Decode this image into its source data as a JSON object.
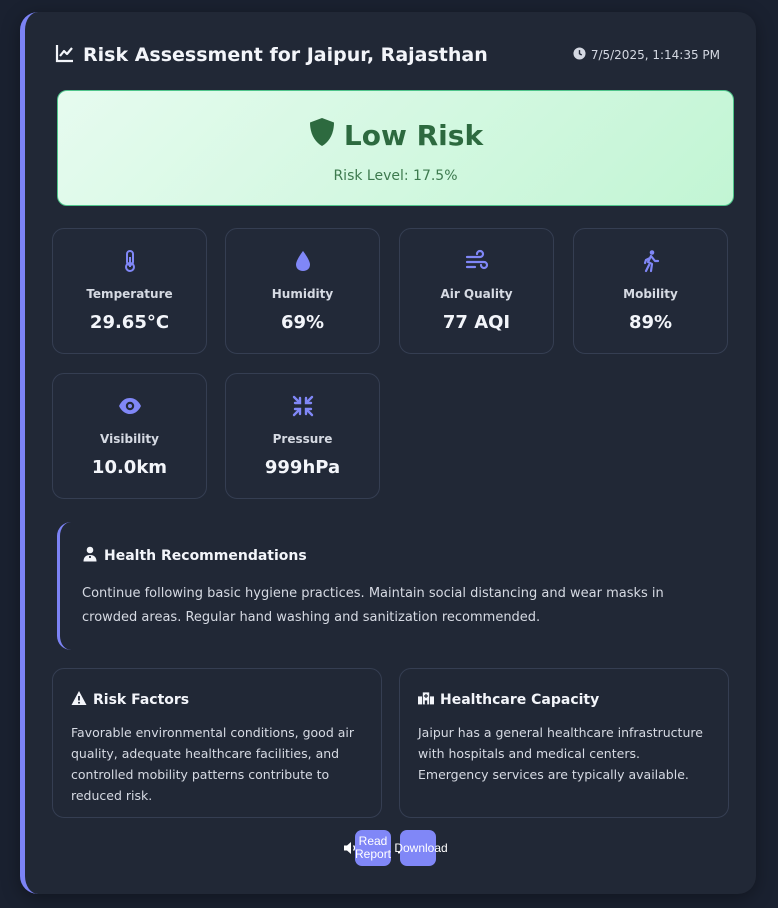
{
  "header": {
    "title": "Risk Assessment for Jaipur, Rajasthan",
    "timestamp": "7/5/2025, 1:14:35 PM",
    "title_icon": "chart-line-icon",
    "timestamp_icon": "clock-icon"
  },
  "risk": {
    "label": "Low Risk",
    "level_text": "Risk Level: 17.5%",
    "icon": "shield-icon"
  },
  "metrics": [
    {
      "label": "Temperature",
      "value": "29.65°C",
      "icon": "thermometer-icon"
    },
    {
      "label": "Humidity",
      "value": "69%",
      "icon": "droplet-icon"
    },
    {
      "label": "Air Quality",
      "value": "77 AQI",
      "icon": "wind-icon"
    },
    {
      "label": "Mobility",
      "value": "89%",
      "icon": "walking-icon"
    },
    {
      "label": "Visibility",
      "value": "10.0km",
      "icon": "eye-icon"
    },
    {
      "label": "Pressure",
      "value": "999hPa",
      "icon": "compress-icon"
    }
  ],
  "recommendations": {
    "title": "Health Recommendations",
    "text": "Continue following basic hygiene practices. Maintain social distancing and wear masks in crowded areas. Regular hand washing and sanitization recommended.",
    "icon": "user-doctor-icon"
  },
  "risk_factors": {
    "title": "Risk Factors",
    "text": "Favorable environmental conditions, good air quality, adequate healthcare facilities, and controlled mobility patterns contribute to reduced risk.",
    "icon": "warning-icon"
  },
  "healthcare": {
    "title": "Healthcare Capacity",
    "text": "Jaipur has a general healthcare infrastructure with hospitals and medical centers. Emergency services are typically available.",
    "icon": "hospital-icon"
  },
  "actions": {
    "read_label": "Read Report",
    "download_label": "Download"
  },
  "colors": {
    "accent": "#7c83f5",
    "low_risk_bg": "#c2f5d4",
    "low_risk_text": "#2d6a3f",
    "card_bg": "#212836"
  }
}
